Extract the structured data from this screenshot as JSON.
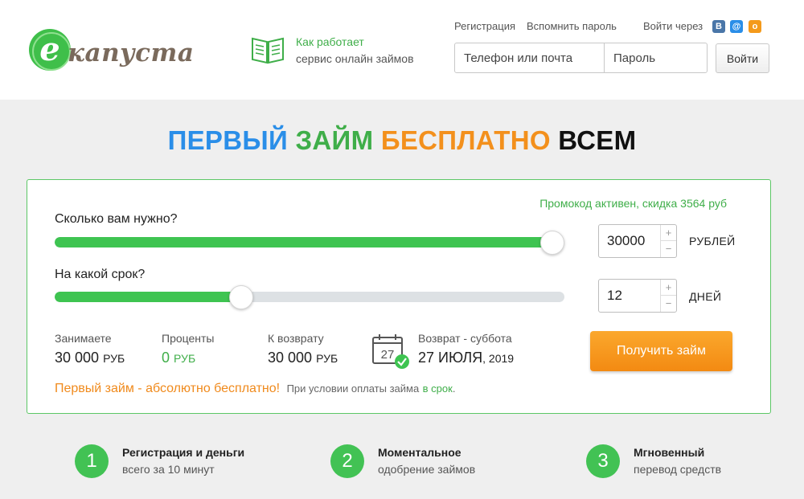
{
  "header": {
    "logo_letter": "e",
    "logo_text": "капуста",
    "how_line1": "Как работает",
    "how_line2": "сервис онлайн займов",
    "links": {
      "register": "Регистрация",
      "remember": "Вспомнить пароль",
      "login_via": "Войти через"
    },
    "social": {
      "vk": "В",
      "mail": "@",
      "ok": "о"
    },
    "login": {
      "phone_placeholder": "Телефон или почта",
      "password_placeholder": "Пароль",
      "button": "Войти"
    }
  },
  "headline": {
    "part1": "ПЕРВЫЙ",
    "part2": "ЗАЙМ",
    "part3": "БЕСПЛАТНО",
    "part4": "ВСЕМ"
  },
  "calculator": {
    "promo": "Промокод активен, скидка 3564 руб",
    "amount": {
      "label": "Сколько вам нужно?",
      "value": "30000",
      "unit": "РУБЛЕЙ",
      "slider_fraction": 1.0
    },
    "term": {
      "label": "На какой срок?",
      "value": "12",
      "unit": "ДНЕЙ",
      "slider_fraction": 0.36
    },
    "stepper": {
      "plus": "+",
      "minus": "−"
    },
    "stats": {
      "borrow_label": "Занимаете",
      "borrow_value": "30 000",
      "borrow_unit": "РУБ",
      "interest_label": "Проценты",
      "interest_value": "0",
      "interest_unit": "РУБ",
      "return_label": "К возврату",
      "return_value": "30 000",
      "return_unit": "РУБ",
      "calendar_day": "27",
      "due_label": "Возврат - суббота",
      "due_value": "27 ИЮЛЯ",
      "due_year": ", 2019"
    },
    "submit": "Получить займ",
    "note": {
      "main": "Первый займ - абсолютно бесплатно!",
      "sub": "При условии оплаты займа",
      "link": "в срок",
      "end": "."
    }
  },
  "features": [
    {
      "num": "1",
      "title": "Регистрация и деньги",
      "sub": "всего за 10 минут"
    },
    {
      "num": "2",
      "title": "Моментальное",
      "sub": "одобрение займов"
    },
    {
      "num": "3",
      "title": "Мгновенный",
      "sub": "перевод средств"
    }
  ],
  "colors": {
    "brand_green": "#3fae49",
    "accent_orange": "#f3901c",
    "accent_blue": "#2a8ee8"
  }
}
